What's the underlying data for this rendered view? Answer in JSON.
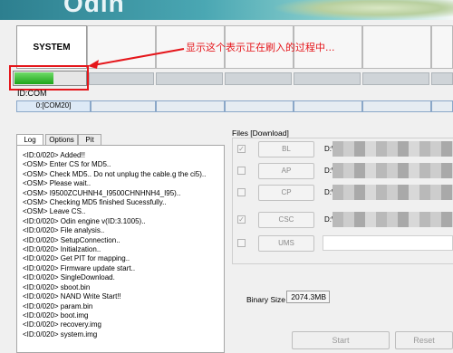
{
  "banner": {
    "logo_text": "Odin"
  },
  "ports": {
    "first_label": "SYSTEM",
    "progress_fraction": 0.55
  },
  "annotation": {
    "text": "显示这个表示正在刷入的过程中..."
  },
  "id_com": {
    "label": "ID:COM",
    "port_value": "0:[COM20]"
  },
  "tabs": [
    "Log",
    "Options",
    "Pit"
  ],
  "log": {
    "lines": [
      "<ID:0/020> Added!!",
      "<OSM> Enter CS for MD5..",
      "<OSM> Check MD5.. Do not unplug the cable.g the ci5)..",
      "<OSM> Please wait..",
      "<OSM> I9500ZCUHNH4_I9500CHNHNH4_I95)..",
      "<OSM> Checking MD5 finished Sucessfully..",
      "<OSM> Leave CS..",
      "<ID:0/020> Odin engine v(ID:3.1005)..",
      "<ID:0/020> File analysis..",
      "<ID:0/020> SetupConnection..",
      "<ID:0/020> Initialzation..",
      "<ID:0/020> Get PIT for mapping..",
      "<ID:0/020> Firmware update start..",
      "<ID:0/020> SingleDownload.",
      "<ID:0/020> sboot.bin",
      "<ID:0/020> NAND Write Start!!",
      "<ID:0/020> param.bin",
      "<ID:0/020> boot.img",
      "<ID:0/020> recovery.img",
      "<ID:0/020> system.img"
    ]
  },
  "files": {
    "title": "Files [Download]",
    "rows": [
      {
        "button": "BL",
        "checked": true,
        "path": "D:\\"
      },
      {
        "button": "AP",
        "checked": false,
        "path": "D:\\"
      },
      {
        "button": "CP",
        "checked": false,
        "path": "D:\\"
      },
      {
        "button": "CSC",
        "checked": true,
        "path": "D:\\"
      },
      {
        "button": "UMS",
        "checked": false,
        "path": ""
      }
    ]
  },
  "binary_size": {
    "label": "Binary Size",
    "value": "2074.3MB"
  },
  "actions": {
    "start_label": "Start",
    "reset_label": "Reset"
  }
}
